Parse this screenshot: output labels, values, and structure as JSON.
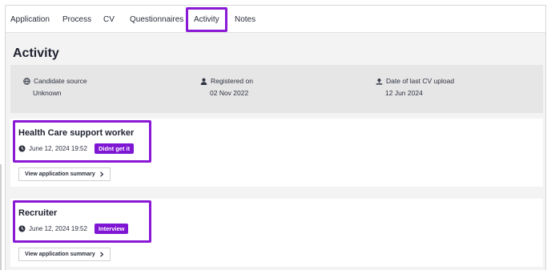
{
  "tabs": [
    {
      "label": "Application"
    },
    {
      "label": "Process"
    },
    {
      "label": "CV"
    },
    {
      "label": "Questionnaires"
    },
    {
      "label": "Activity"
    },
    {
      "label": "Notes"
    }
  ],
  "active_tab": "Activity",
  "highlight_color": "#8a19d6",
  "badge_color": "#7e16d3",
  "page": {
    "title": "Activity"
  },
  "info": {
    "candidate_source": {
      "label": "Candidate source",
      "value": "Unknown",
      "icon": "globe-icon"
    },
    "registered_on": {
      "label": "Registered on",
      "value": "02 Nov 2022",
      "icon": "user-icon"
    },
    "last_cv_upload": {
      "label": "Date of last CV upload",
      "value": "12 Jun 2024",
      "icon": "upload-icon"
    }
  },
  "applications": [
    {
      "title": "Health Care support worker",
      "datetime": "June 12, 2024 19:52",
      "status": "Didnt get it",
      "button_label": "View application summary"
    },
    {
      "title": "Recruiter",
      "datetime": "June 12, 2024 19:52",
      "status": "Interview",
      "button_label": "View application summary"
    }
  ]
}
